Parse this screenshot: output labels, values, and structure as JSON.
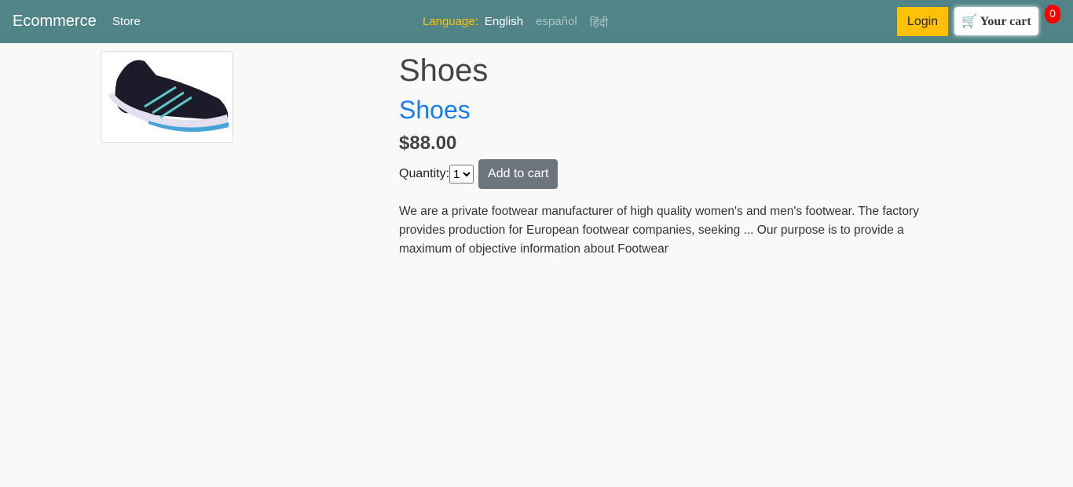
{
  "nav": {
    "brand": "Ecommerce",
    "store": "Store",
    "language_label": "Language:",
    "languages": [
      "English",
      "español",
      "हिंदी"
    ],
    "login": "Login",
    "cart": "Your cart",
    "cart_count": "0"
  },
  "product": {
    "title": "Shoes",
    "name": "Shoes",
    "price": "$88.00",
    "quantity_label": "Quantity:",
    "quantity": "1",
    "add_to_cart": "Add to cart",
    "description": "We are a private footwear manufacturer of high quality women's and men's footwear. The factory provides production for European footwear companies, seeking ... Our purpose is to provide a maximum of objective information about Footwear"
  }
}
